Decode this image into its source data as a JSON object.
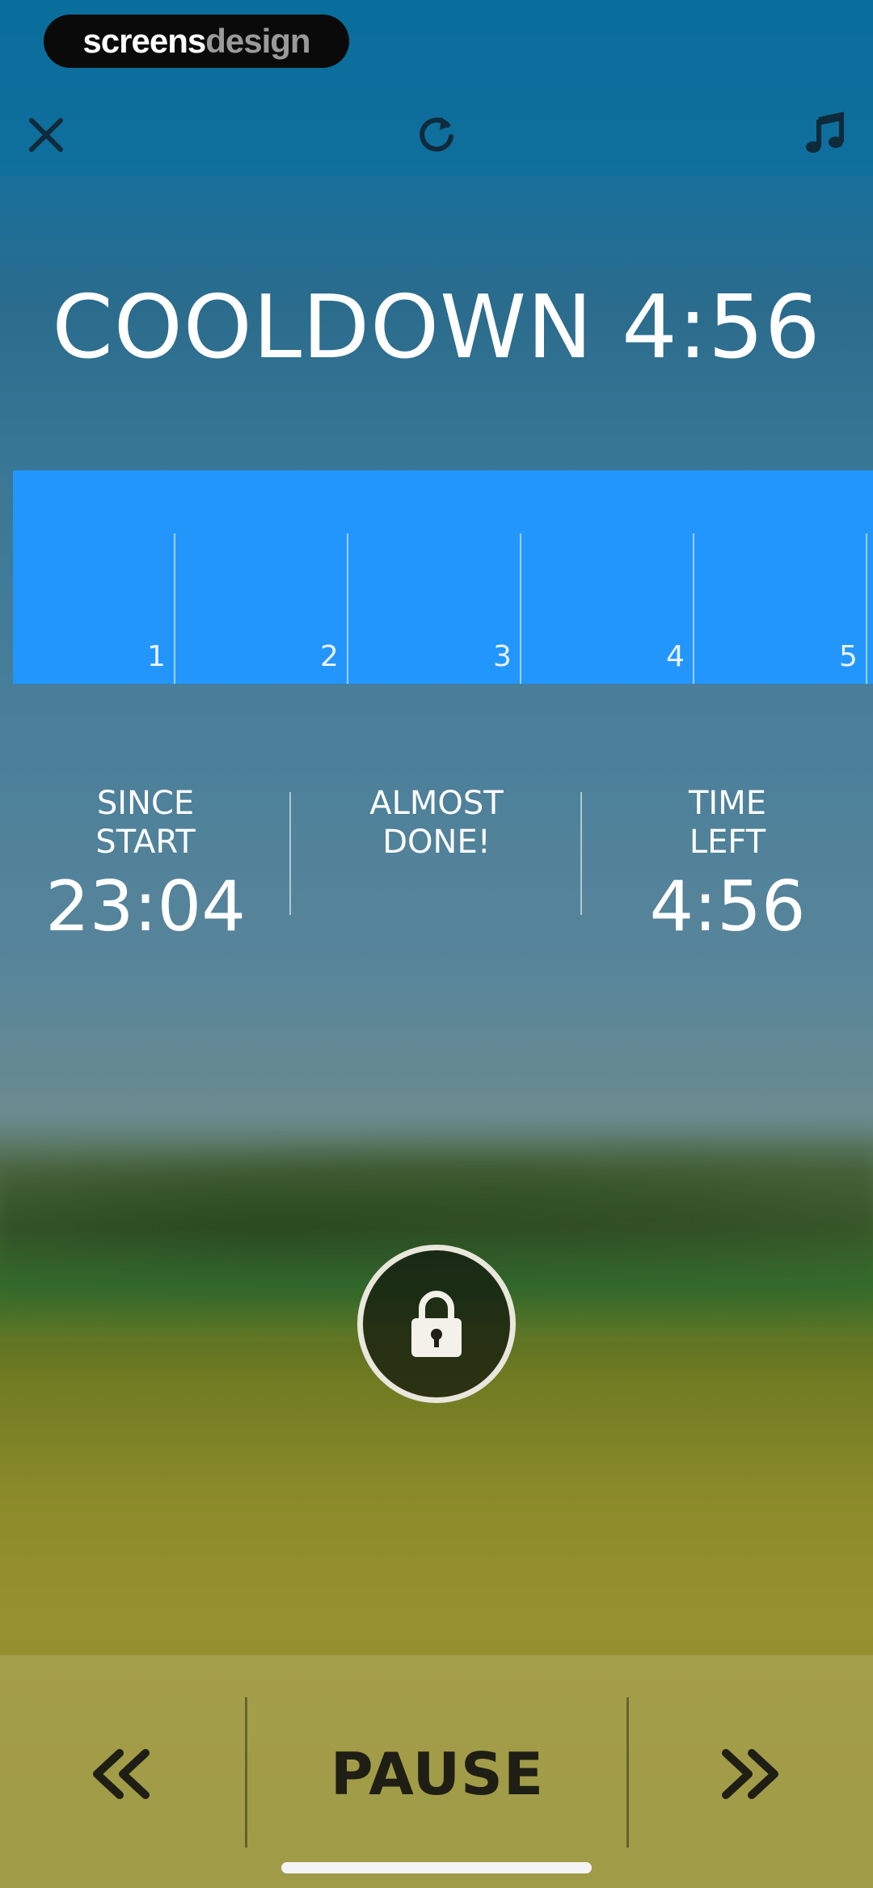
{
  "brand": {
    "part1": "screens",
    "part2": "design"
  },
  "toolbar": {
    "close_icon": "close-icon",
    "restart_icon": "restart-icon",
    "music_icon": "music-note-icon"
  },
  "phase": {
    "title": "COOLDOWN 4:56"
  },
  "intervals": {
    "color": "#2396fc",
    "labels": [
      "1",
      "2",
      "3",
      "4",
      "5"
    ]
  },
  "stats": {
    "since_start": {
      "label_line1": "SINCE",
      "label_line2": "START",
      "value": "23:04"
    },
    "message": {
      "line1": "ALMOST",
      "line2": "DONE!"
    },
    "time_left": {
      "label_line1": "TIME",
      "label_line2": "LEFT",
      "value": "4:56"
    }
  },
  "lock": {
    "icon": "lock-icon"
  },
  "controls": {
    "prev_icon": "rewind-icon",
    "pause_label": "PAUSE",
    "next_icon": "fast-forward-icon"
  }
}
